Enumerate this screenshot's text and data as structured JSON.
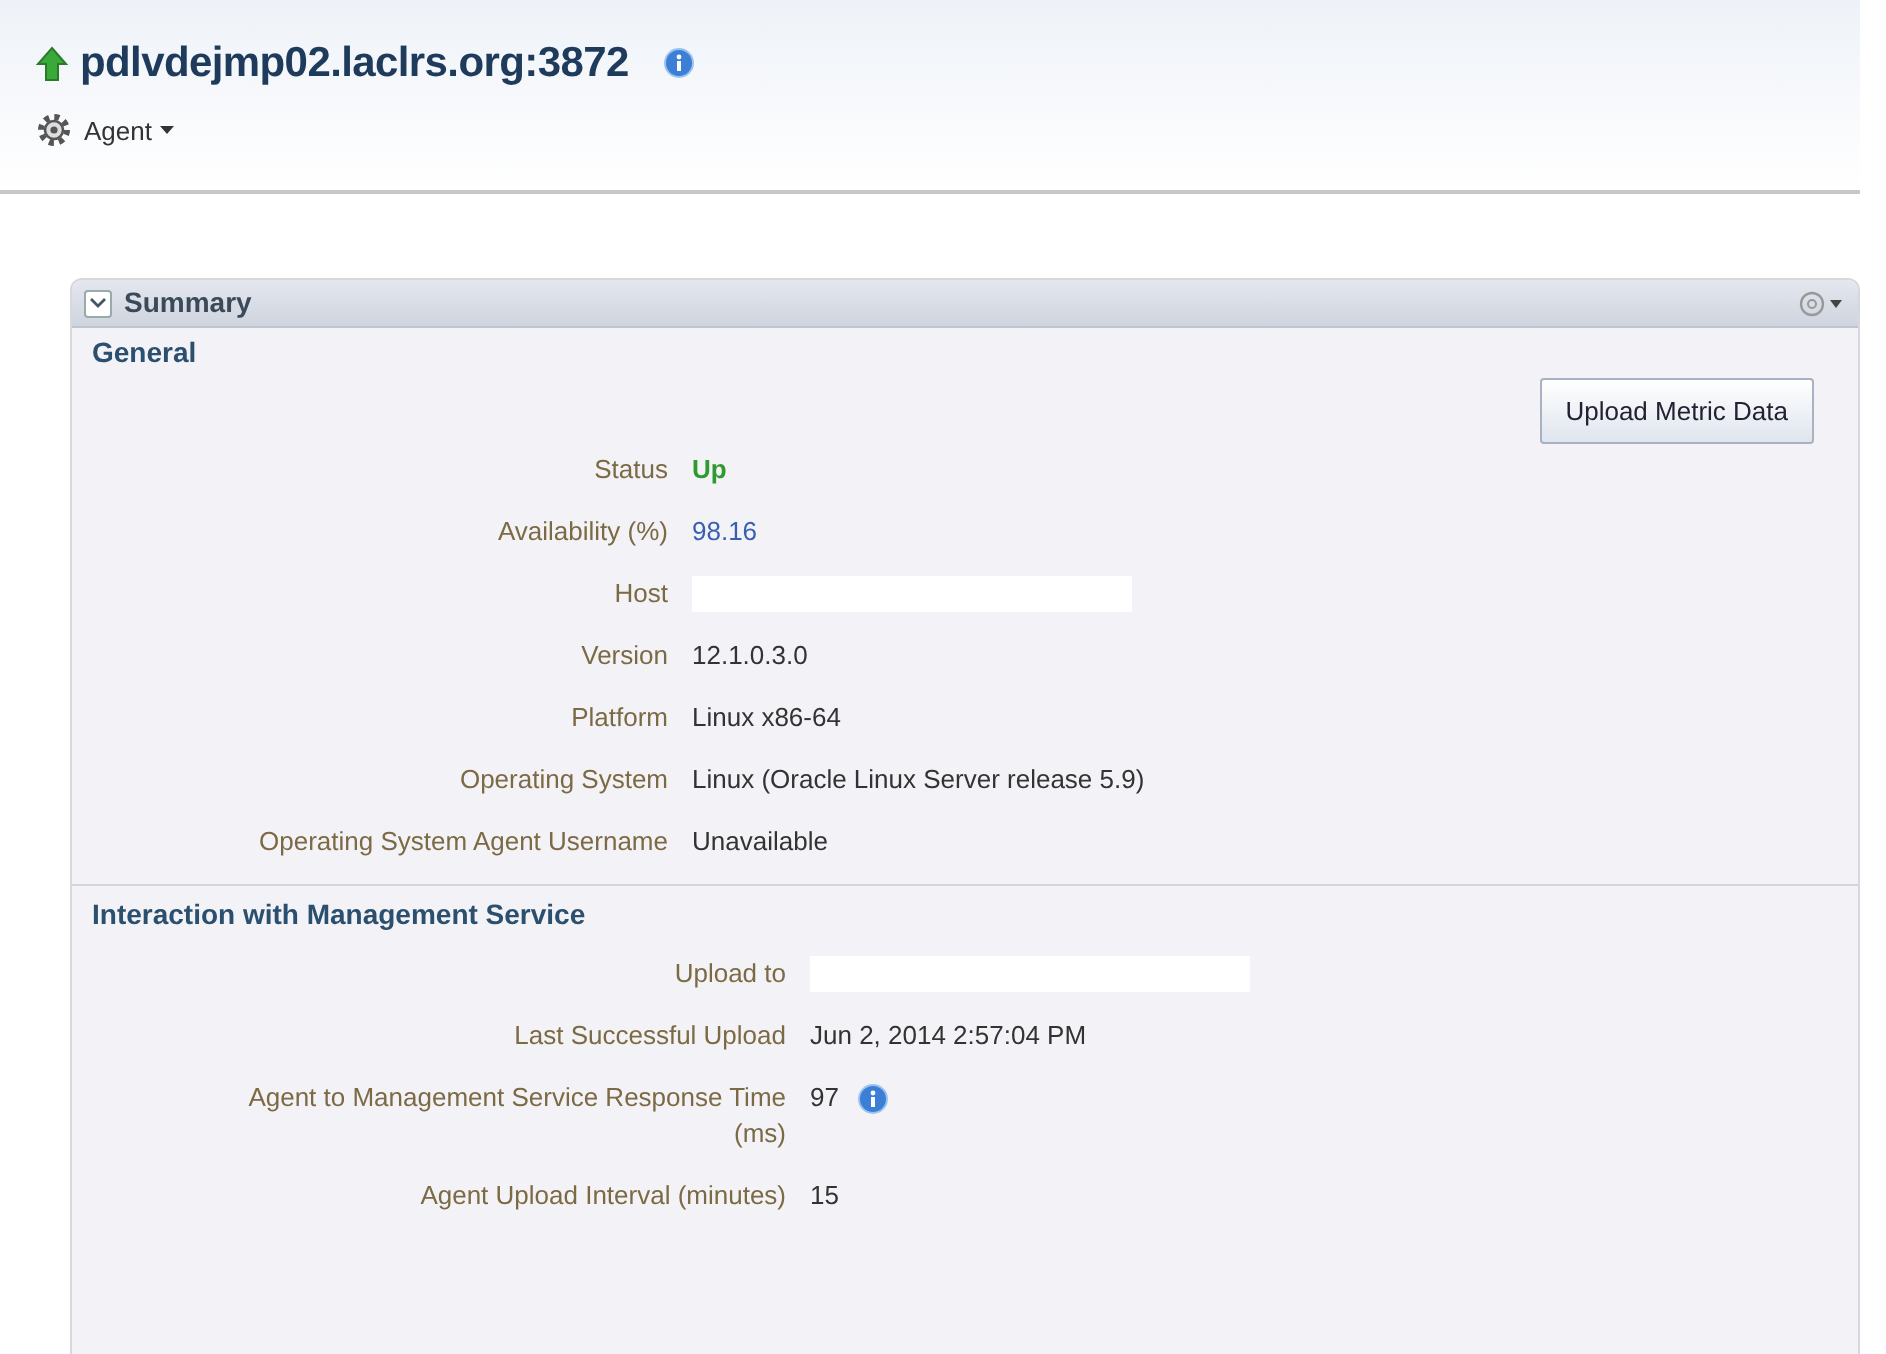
{
  "header": {
    "title": "pdlvdejmp02.laclrs.org:3872",
    "menu": "Agent",
    "up": true
  },
  "panel": {
    "title": "Summary",
    "expanded": true,
    "sections": [
      {
        "title": "General",
        "button": "Upload Metric Data",
        "rows": [
          {
            "label": "Status",
            "kind": "status",
            "value": "Up"
          },
          {
            "label": "Availability (%)",
            "kind": "link",
            "value": "98.16"
          },
          {
            "label": "Host",
            "kind": "redacted"
          },
          {
            "label": "Version",
            "kind": "text",
            "value": "12.1.0.3.0"
          },
          {
            "label": "Platform",
            "kind": "text",
            "value": "Linux x86-64"
          },
          {
            "label": "Operating System",
            "kind": "text",
            "value": "Linux (Oracle Linux Server release 5.9)"
          },
          {
            "label": "Operating System Agent Username",
            "kind": "text",
            "value": "Unavailable"
          }
        ]
      },
      {
        "title": "Interaction with Management Service",
        "rows": [
          {
            "label": "Upload to",
            "kind": "redacted"
          },
          {
            "label": "Last Successful Upload",
            "kind": "text",
            "value": "Jun 2, 2014 2:57:04 PM"
          },
          {
            "label": "Agent to Management Service Response Time (ms)",
            "kind": "info",
            "value": "97"
          },
          {
            "label": "Agent Upload Interval (minutes)",
            "kind": "text",
            "value": "15"
          }
        ]
      }
    ]
  }
}
